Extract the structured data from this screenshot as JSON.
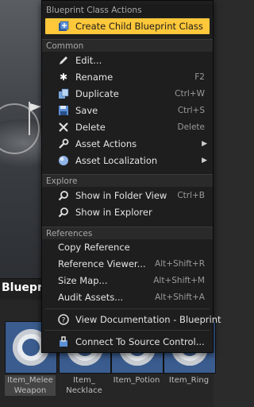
{
  "blueprint_title": "Blueprint",
  "menu": {
    "sections": {
      "blueprint_class_actions": "Blueprint Class Actions",
      "common": "Common",
      "explore": "Explore",
      "references": "References"
    },
    "items": {
      "create_child": "Create Child Blueprint Class",
      "edit": "Edit...",
      "rename": "Rename",
      "rename_sc": "F2",
      "duplicate": "Duplicate",
      "duplicate_sc": "Ctrl+W",
      "save": "Save",
      "save_sc": "Ctrl+S",
      "delete": "Delete",
      "delete_sc": "Delete",
      "asset_actions": "Asset Actions",
      "asset_localization": "Asset Localization",
      "show_folder": "Show in Folder View",
      "show_folder_sc": "Ctrl+B",
      "show_explorer": "Show in Explorer",
      "copy_reference": "Copy Reference",
      "reference_viewer": "Reference Viewer...",
      "reference_viewer_sc": "Alt+Shift+R",
      "size_map": "Size Map...",
      "size_map_sc": "Alt+Shift+M",
      "audit_assets": "Audit Assets...",
      "audit_assets_sc": "Alt+Shift+A",
      "view_docs": "View Documentation - Blueprint",
      "connect_source": "Connect To Source Control..."
    }
  },
  "assets": [
    {
      "name": "Item_Melee Weapon",
      "selected": true
    },
    {
      "name": "Item_ Necklace"
    },
    {
      "name": "Item_Potion"
    },
    {
      "name": "Item_Ring"
    }
  ],
  "colors": {
    "highlight": "#ffc83a",
    "asset_thumb": "#3a5c8e"
  }
}
